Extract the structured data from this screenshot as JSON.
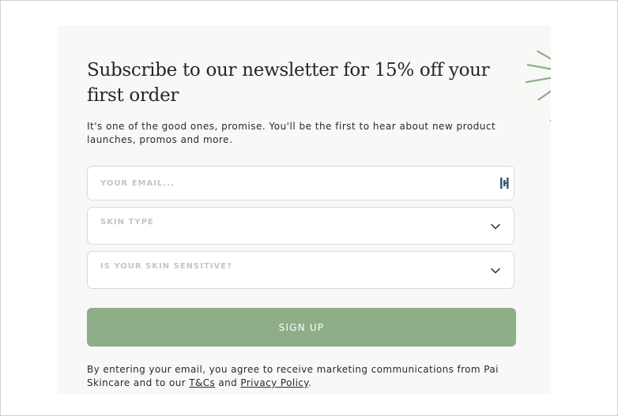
{
  "headline": "Subscribe to our newsletter for 15% off your first order",
  "intro": "It's one of the good ones, promise. You'll be the first to hear about new product launches, promos and more.",
  "form": {
    "email_placeholder": "YOUR EMAIL...",
    "skin_type_placeholder": "SKIN TYPE",
    "sensitive_placeholder": "IS YOUR SKIN SENSITIVE?",
    "submit_label": "SIGN UP"
  },
  "legal": {
    "prefix": "By entering your email, you agree to receive marketing communications from Pai Skincare and to our ",
    "terms_link": "T&Cs",
    "middle": " and ",
    "privacy_link": "Privacy Policy",
    "suffix": "."
  },
  "icons": {
    "decoration": "sun-icon",
    "email_field_helper": "password-manager-icon",
    "select_arrow": "chevron-down-icon"
  },
  "colors": {
    "panel_background": "#f8f8f7",
    "accent_green": "#8eae88",
    "sun_green": "#8eae88",
    "text_dark": "#262626",
    "placeholder": "#c4c4c4",
    "field_border": "#d9d9d9"
  }
}
